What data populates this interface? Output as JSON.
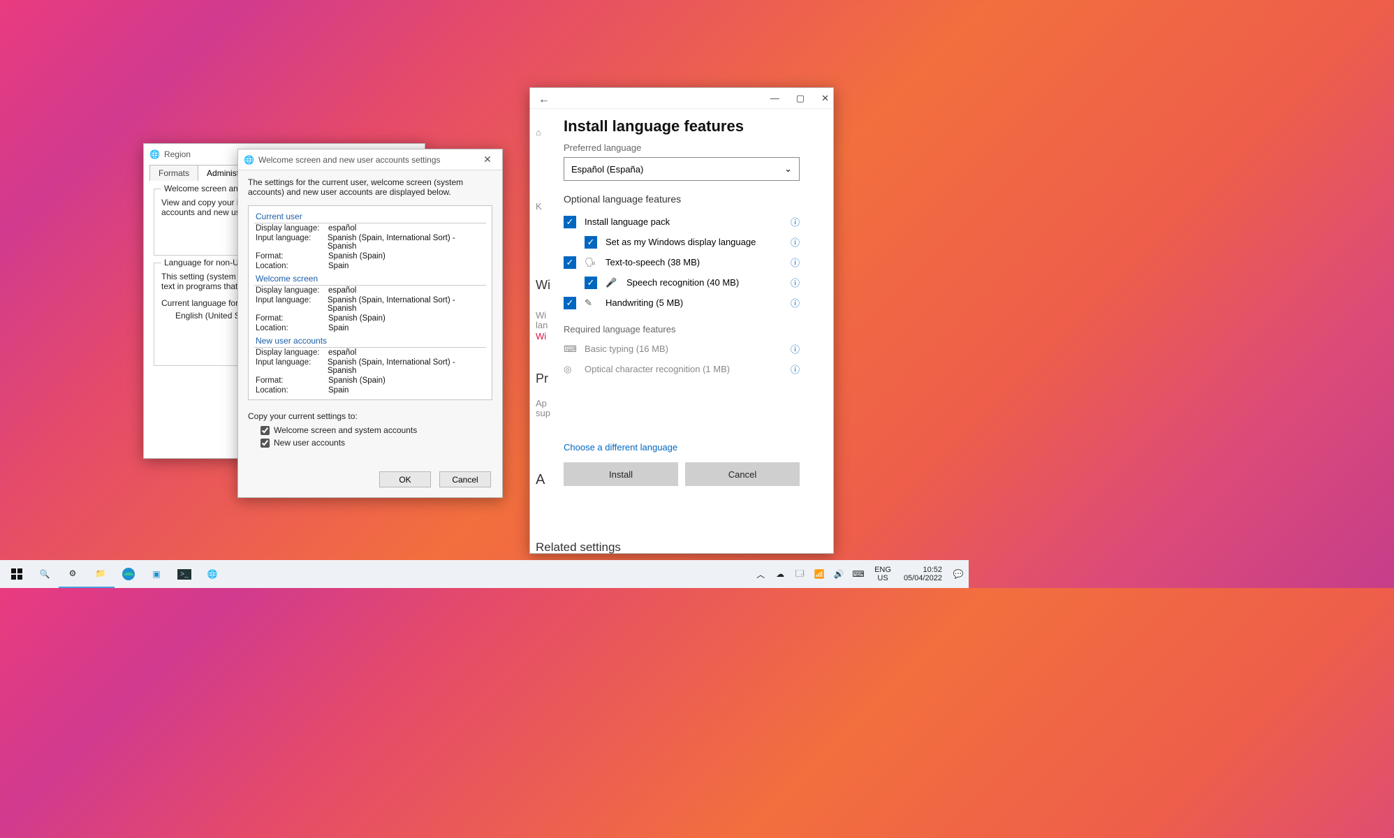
{
  "region_window": {
    "title": "Region",
    "tabs": {
      "formats": "Formats",
      "administrative": "Administrative"
    },
    "group1_title": "Welcome screen and new",
    "group1_text": "View and copy your inte\naccounts and new user a",
    "group2_title": "Language for non-Unico",
    "group2_text1": "This setting (system loca\ntext in programs that do",
    "group2_text2": "Current language for no",
    "group2_val": "English (United State"
  },
  "welcome_dialog": {
    "title": "Welcome screen and new user accounts settings",
    "intro": "The settings for the current user, welcome screen (system accounts) and new user accounts are displayed below.",
    "sections": {
      "current": "Current user",
      "welcome": "Welcome screen",
      "newuser": "New user accounts"
    },
    "labels": {
      "display": "Display language:",
      "input": "Input language:",
      "format": "Format:",
      "location": "Location:"
    },
    "values": {
      "display": "español",
      "input": "Spanish (Spain, International Sort) - Spanish",
      "format": "Spanish (Spain)",
      "location": "Spain"
    },
    "copy_label": "Copy your current settings to:",
    "chk1": "Welcome screen and system accounts",
    "chk2": "New user accounts",
    "ok": "OK",
    "cancel": "Cancel"
  },
  "settings_window": {
    "heading": "Install language features",
    "pref_label": "Preferred language",
    "pref_value": "Español (España)",
    "optional_title": "Optional language features",
    "features": {
      "pack": "Install language pack",
      "display": "Set as my Windows display language",
      "tts": "Text-to-speech (38 MB)",
      "speech": "Speech recognition (40 MB)",
      "hand": "Handwriting (5 MB)"
    },
    "required_title": "Required language features",
    "required": {
      "typing": "Basic typing (16 MB)",
      "ocr": "Optical character recognition (1 MB)"
    },
    "link": "Choose a different language",
    "install": "Install",
    "cancel": "Cancel",
    "bg_partials": {
      "k": "K",
      "wi": "Wi",
      "wi2": "Wi",
      "lan": "lan",
      "wi3": "Wi",
      "pr": "Pr",
      "ap": "Ap",
      "sup": "sup",
      "a": "A",
      "rel": "Related settings"
    }
  },
  "taskbar": {
    "lang1": "ENG",
    "lang2": "US",
    "time": "10:52",
    "date": "05/04/2022"
  }
}
